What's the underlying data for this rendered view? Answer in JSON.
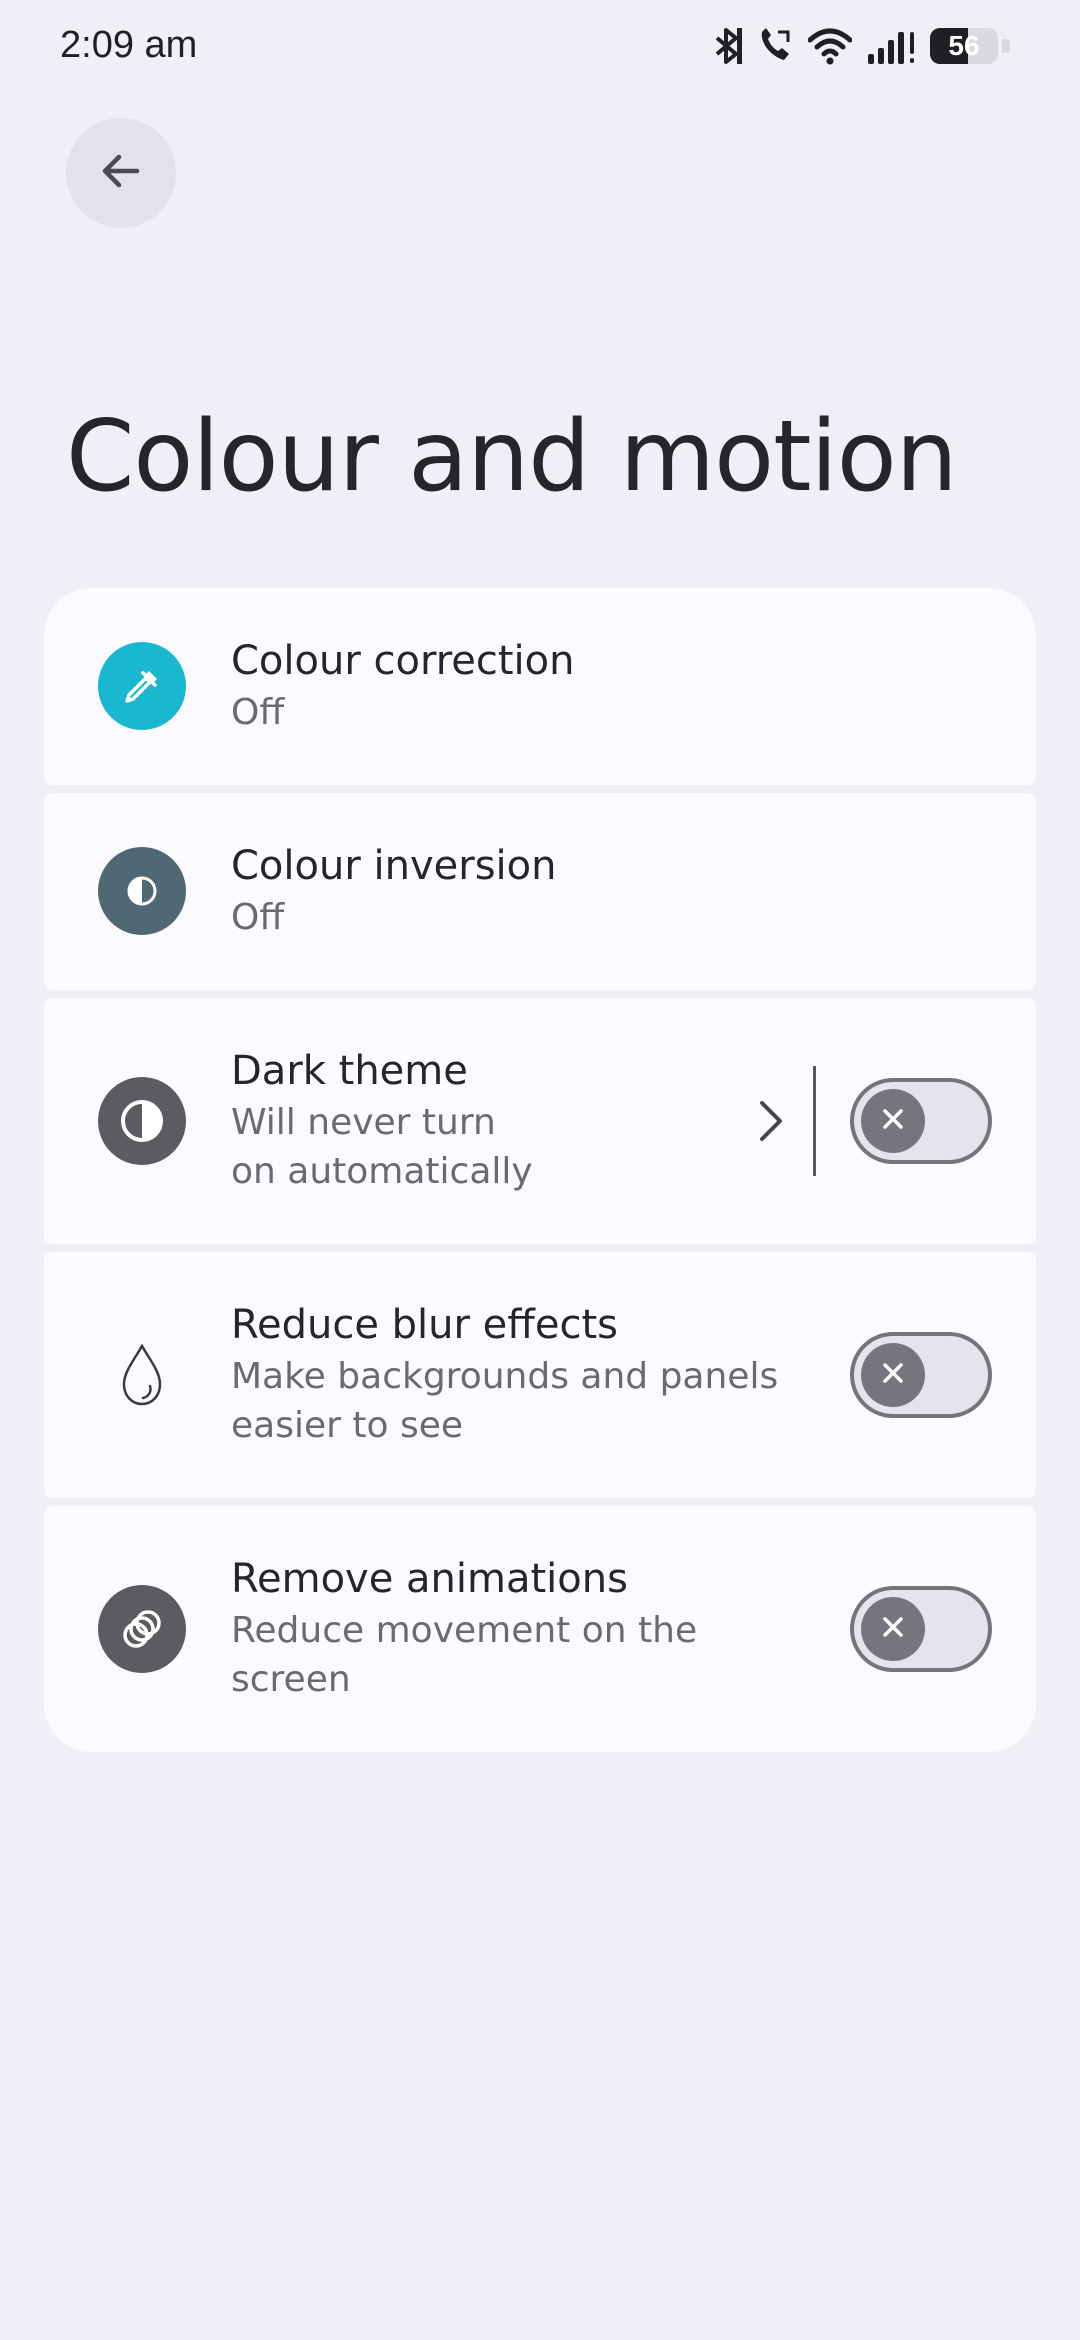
{
  "status_bar": {
    "time": "2:09 am",
    "battery": "56",
    "icons": [
      "bluetooth-icon",
      "wifi-calling-icon",
      "wifi-icon",
      "signal-icon",
      "battery-icon"
    ]
  },
  "header": {
    "back_icon": "arrow-left-icon",
    "title": "Colour and motion"
  },
  "settings": [
    {
      "title": "Colour correction",
      "summary": "Off",
      "icon": "eyedropper-icon",
      "icon_color": "#1ab8d0"
    },
    {
      "title": "Colour inversion",
      "summary": "Off",
      "icon": "colour-inversion-icon",
      "icon_color": "#4f6873"
    },
    {
      "title": "Dark theme",
      "summary": "Will never turn on automatically",
      "icon": "dark-theme-icon",
      "icon_color": "#5b5b60",
      "has_chevron": true,
      "toggle_on": false
    },
    {
      "title": "Reduce blur effects",
      "summary": "Make backgrounds and panels easier to see",
      "icon": "water-drop-icon",
      "toggle_on": false
    },
    {
      "title": "Remove animations",
      "summary": "Reduce movement on the screen",
      "icon": "animation-circles-icon",
      "icon_color": "#5b5b60",
      "toggle_on": false
    }
  ],
  "colors": {
    "background": "#efeff7",
    "card": "#fbfafe",
    "toggle_track": "#e4e3ee",
    "toggle_thumb": "#76757d"
  }
}
